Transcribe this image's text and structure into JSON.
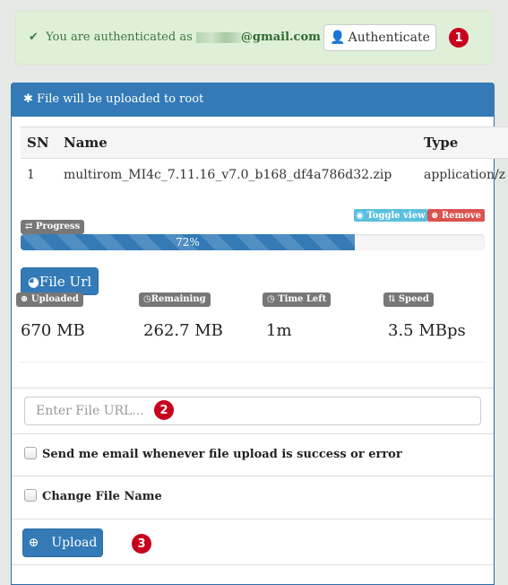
{
  "auth": {
    "message": "You are authenticated as",
    "email_visible": "@gmail.com",
    "button_label": "Authenticate",
    "badge": "1"
  },
  "panel": {
    "heading": "File will be uploaded to root"
  },
  "table": {
    "headers": [
      "SN",
      "Name",
      "Type"
    ],
    "rows": [
      {
        "sn": "1",
        "name": "multirom_MI4c_7.11.16_v7.0_b168_df4a786d32.zip",
        "type": "application/z"
      }
    ]
  },
  "progress": {
    "label": "Progress",
    "percent": 72,
    "percent_text": "72%",
    "toggle_label": "Toggle view",
    "remove_label": "Remove"
  },
  "file_url_button": "File Url",
  "stats": [
    {
      "label": "Uploaded",
      "value": "670 MB",
      "icon": "upload-circle-icon"
    },
    {
      "label": "Remaining",
      "value": "262.7 MB",
      "icon": "clock-icon"
    },
    {
      "label": "Time Left",
      "value": "1m",
      "icon": "clock-icon"
    },
    {
      "label": "Speed",
      "value": "3.5 MBps",
      "icon": "sort-arrows-icon"
    }
  ],
  "url_input": {
    "placeholder": "Enter File URL...",
    "value": "",
    "badge": "2"
  },
  "options": {
    "email_label": "Send me email whenever file upload is success or error",
    "email_checked": false,
    "rename_label": "Change File Name",
    "rename_checked": false
  },
  "upload": {
    "label": "Upload",
    "badge": "3"
  },
  "colors": {
    "primary": "#337ab7",
    "success_bg": "#dff0d8",
    "danger": "#d9534f",
    "info": "#5bc0de",
    "badge": "#c8001e"
  }
}
